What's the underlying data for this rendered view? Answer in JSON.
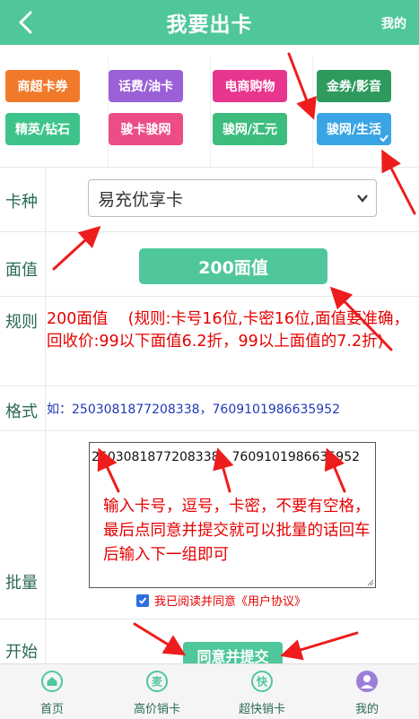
{
  "header": {
    "title": "我要出卡",
    "right_link": "我的"
  },
  "categories": [
    {
      "label": "商超卡券",
      "color": "#f07a2a"
    },
    {
      "label": "话费/油卡",
      "color": "#9b5fd8"
    },
    {
      "label": "电商购物",
      "color": "#e8358e"
    },
    {
      "label": "金券/影音",
      "color": "#2e9a5e"
    },
    {
      "label": "精英/钻石",
      "color": "#3ec48a"
    },
    {
      "label": "骏卡骏网",
      "color": "#ec4d86"
    },
    {
      "label": "骏网/汇元",
      "color": "#3cbd7e"
    },
    {
      "label": "骏网/生活",
      "color": "#3aa5e4",
      "selected": true
    }
  ],
  "form": {
    "card_type": {
      "label": "卡种",
      "value": "易充优享卡"
    },
    "face_value": {
      "label": "面值",
      "value": "200面值"
    },
    "rules": {
      "label": "规则",
      "text": "200面值    (规则:卡号16位,卡密16位,面值要准确，回收价:99以下面值6.2折，99以上面值的7.2折)"
    },
    "format": {
      "label": "格式",
      "text": "如：2503081877208338，7609101986635952"
    },
    "batch": {
      "label": "批量",
      "value": "2503081877208338，7609101986635952",
      "instruction": "输入卡号，逗号，卡密，不要有空格，最后点同意并提交就可以批量的话回车后输入下一组即可"
    },
    "agreement": {
      "text": "我已阅读并同意",
      "link": "《用户协议》",
      "checked": true
    },
    "start": {
      "label": "开始",
      "submit": "同意并提交"
    }
  },
  "tabbar": [
    {
      "label": "首页",
      "icon": "home-icon",
      "glyph": ""
    },
    {
      "label": "高价销卡",
      "icon": "sell-icon",
      "glyph": "麦"
    },
    {
      "label": "超快销卡",
      "icon": "fast-icon",
      "glyph": "快"
    },
    {
      "label": "我的",
      "icon": "user-icon",
      "glyph": ""
    }
  ],
  "colors": {
    "brand": "#4fc79b",
    "alert": "#e60000",
    "link": "#2238b8"
  }
}
